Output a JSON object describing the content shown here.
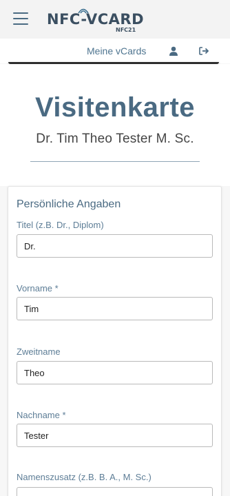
{
  "header": {
    "logo_text": "NFC-VCARD",
    "logo_sub": "NFC21"
  },
  "icons": {
    "menu": "hamburger-menu",
    "user": "user-icon",
    "logout": "sign-out-icon"
  },
  "subnav": {
    "my_vcards_label": "Meine vCards"
  },
  "hero": {
    "title": "Visitenkarte",
    "subtitle": "Dr. Tim Theo Tester M. Sc."
  },
  "form": {
    "section_title": "Persönliche Angaben",
    "fields": [
      {
        "label": "Titel (z.B. Dr., Diplom)",
        "value": "Dr."
      },
      {
        "label": "Vorname *",
        "value": "Tim"
      },
      {
        "label": "Zweitname",
        "value": "Theo"
      },
      {
        "label": "Nachname *",
        "value": "Tester"
      },
      {
        "label": "Namenszusatz (z.B. B. A., M. Sc.)",
        "value": ""
      }
    ]
  },
  "colors": {
    "accent": "#4a6a82",
    "link": "#4f7590",
    "topbar_bg": "#f3f3f3"
  }
}
